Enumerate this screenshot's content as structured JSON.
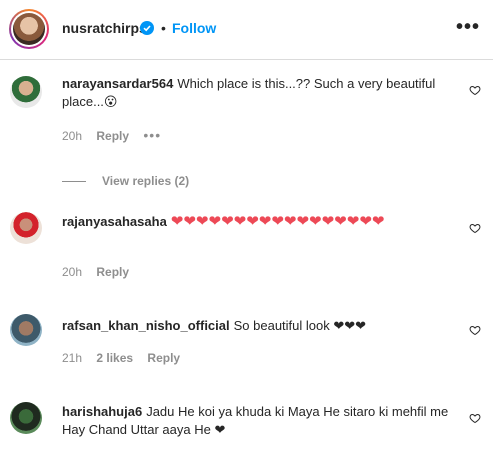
{
  "header": {
    "username": "nusratchirps",
    "dot": "•",
    "follow_label": "Follow",
    "more_icon": "more-horizontal-icon"
  },
  "comments": [
    {
      "username": "narayansardar564",
      "text": "Which place is this...?? Such a very beautiful place...😮",
      "time": "20h",
      "reply_label": "Reply",
      "options": "•••"
    },
    {
      "view_replies_label": "View replies (2)"
    },
    {
      "username": "rajanyasahasaha",
      "text": "❤❤❤❤❤❤❤❤❤❤❤❤❤❤❤❤❤",
      "time": "20h",
      "reply_label": "Reply"
    },
    {
      "username": "rafsan_khan_nisho_official",
      "text": "So beautiful look ❤❤❤",
      "time": "21h",
      "likes": "2 likes",
      "reply_label": "Reply"
    },
    {
      "username": "harishahuja6",
      "text": "Jadu He koi ya khuda ki Maya He sitaro ki mehfil me Hay Chand Uttar aaya He ❤"
    }
  ],
  "colors": {
    "accent": "#0095f6",
    "heart": "#ed4956",
    "muted": "#8e8e8e"
  }
}
